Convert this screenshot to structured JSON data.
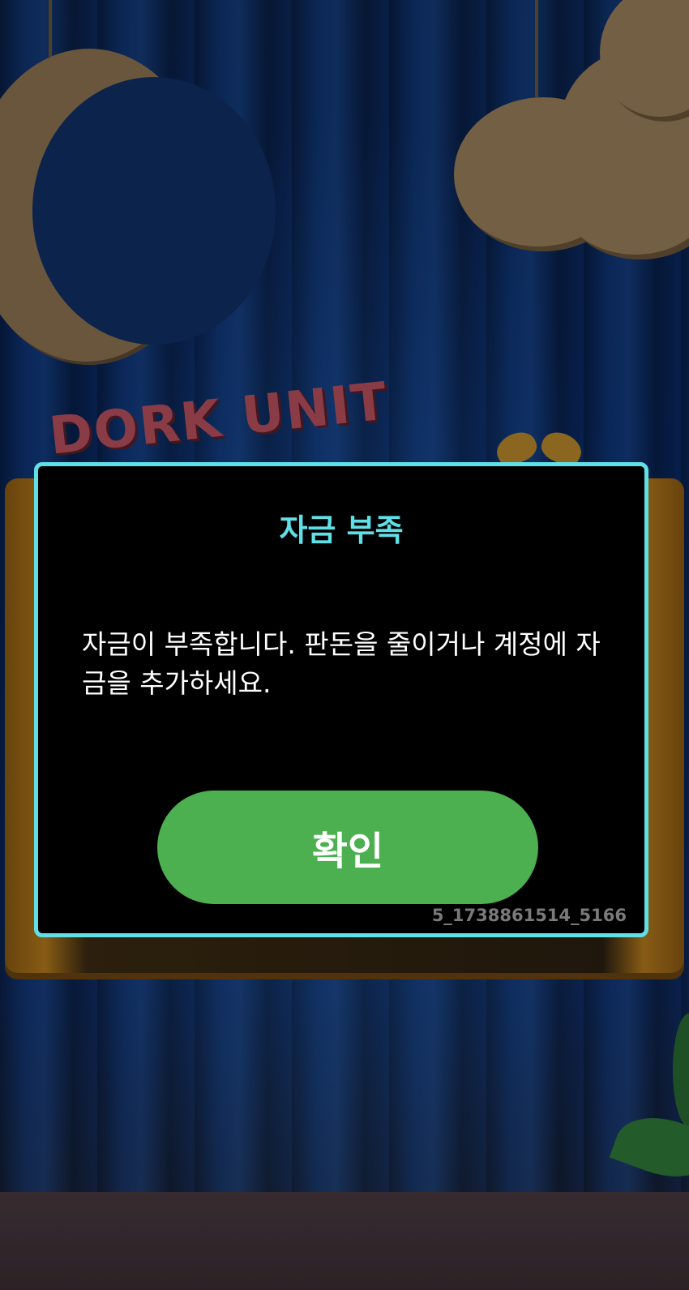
{
  "dialog": {
    "title": "자금 부족",
    "message": "자금이 부족합니다. 판돈을 줄이거나 계정에 자금을 추가하세요.",
    "confirm_label": "확인",
    "session_id": "5_1738861514_5166"
  },
  "background": {
    "logo_text": "DORK UNIT"
  },
  "colors": {
    "accent": "#5fe0e6",
    "confirm_button": "#4caf50",
    "dialog_background": "#000000"
  }
}
